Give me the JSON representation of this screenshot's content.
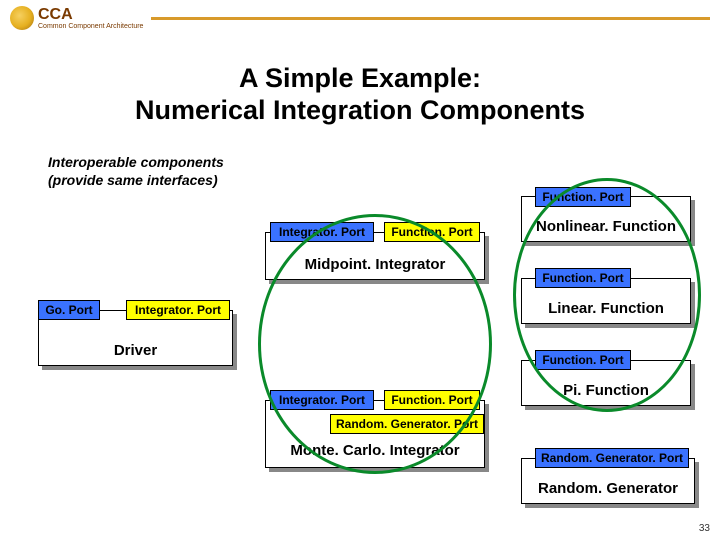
{
  "header": {
    "acronym": "CCA",
    "subtitle": "Common Component Architecture"
  },
  "title_line1": "A Simple Example:",
  "title_line2": "Numerical Integration Components",
  "intro_line1": "Interoperable components",
  "intro_line2": "(provide same interfaces)",
  "ports": {
    "go": "Go. Port",
    "integrator": "Integrator. Port",
    "function": "Function. Port",
    "randomgen": "Random. Generator. Port"
  },
  "components": {
    "driver": "Driver",
    "midpoint": "Midpoint. Integrator",
    "montecarlo": "Monte. Carlo. Integrator",
    "nonlinear": "Nonlinear. Function",
    "linear": "Linear. Function",
    "pi": "Pi. Function",
    "randomgen": "Random. Generator"
  },
  "page_number": "33"
}
